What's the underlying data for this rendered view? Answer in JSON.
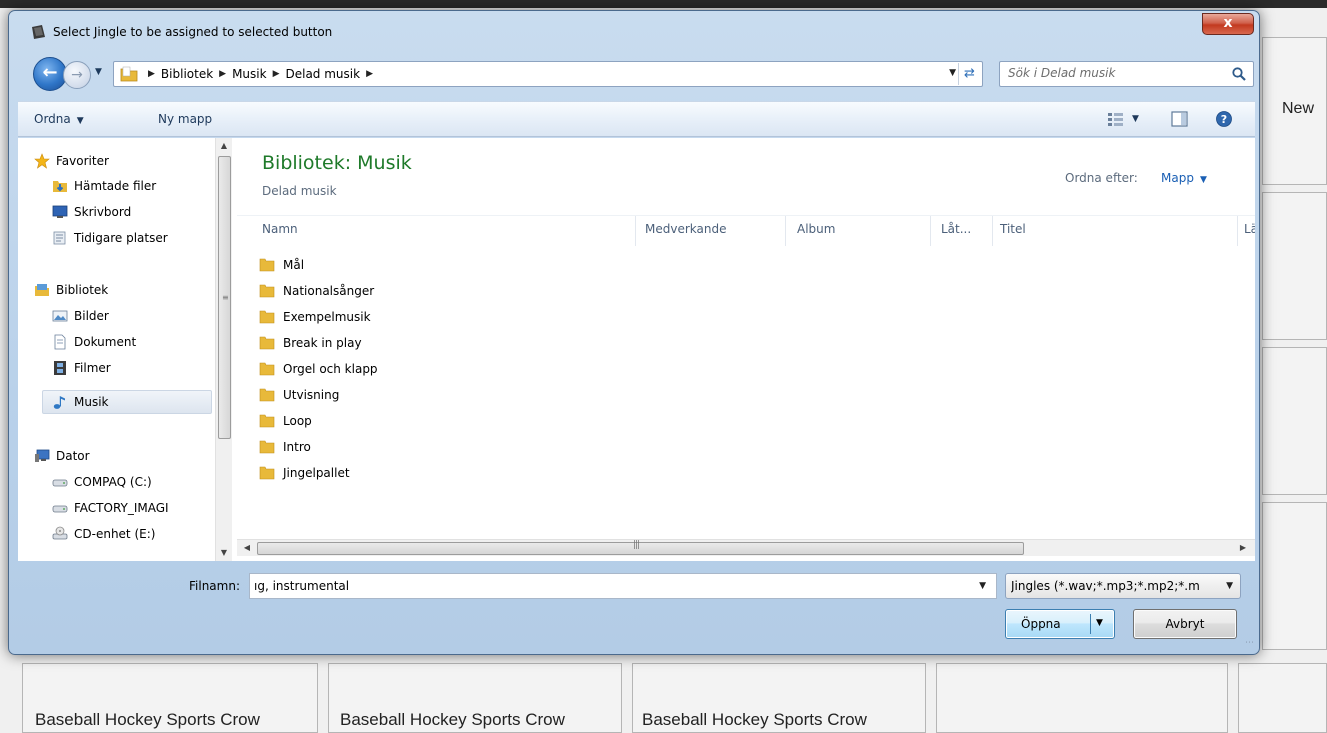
{
  "background": {
    "new_label": "New",
    "button_labels": [
      "Baseball Hockey Sports Crow",
      "Baseball Hockey Sports Crow",
      "Baseball Hockey Sports Crow"
    ]
  },
  "dialog": {
    "title": "Select Jingle to be assigned to selected button",
    "close_label": "x",
    "breadcrumbs": [
      "Bibliotek",
      "Musik",
      "Delad musik"
    ],
    "search_placeholder": "Sök i Delad musik",
    "toolbar": {
      "organize_label": "Ordna",
      "new_folder_label": "Ny mapp"
    },
    "nav_pane": {
      "favorites_header": "Favoriter",
      "favorites": [
        "Hämtade filer",
        "Skrivbord",
        "Tidigare platser"
      ],
      "libraries_header": "Bibliotek",
      "libraries": [
        "Bilder",
        "Dokument",
        "Filmer",
        "Musik"
      ],
      "computer_header": "Dator",
      "drives": [
        "COMPAQ (C:)",
        "FACTORY_IMAGI",
        "CD-enhet (E:)"
      ],
      "selected": "Musik"
    },
    "file_pane": {
      "library_title": "Bibliotek: Musik",
      "library_subtitle": "Delad musik",
      "sort_label": "Ordna efter:",
      "sort_value": "Mapp",
      "columns": [
        "Namn",
        "Medverkande",
        "Album",
        "Låt...",
        "Titel",
        "Lä"
      ],
      "folders": [
        "Mål",
        "Nationalsånger",
        "Exempelmusik",
        "Break in play",
        "Orgel och klapp",
        "Utvisning",
        "Loop",
        "Intro",
        "Jingelpallet"
      ]
    },
    "filename_label": "Filnamn:",
    "filename_value": "ıg, instrumental",
    "filetype_value": "Jingles (*.wav;*.mp3;*.mp2;*.m",
    "open_label": "Öppna",
    "cancel_label": "Avbryt"
  },
  "colors": {
    "library_title": "#1f7a2a",
    "sort_link": "#1a5fb4",
    "folder": "#e8b93a",
    "close_button": "#c2391f"
  }
}
